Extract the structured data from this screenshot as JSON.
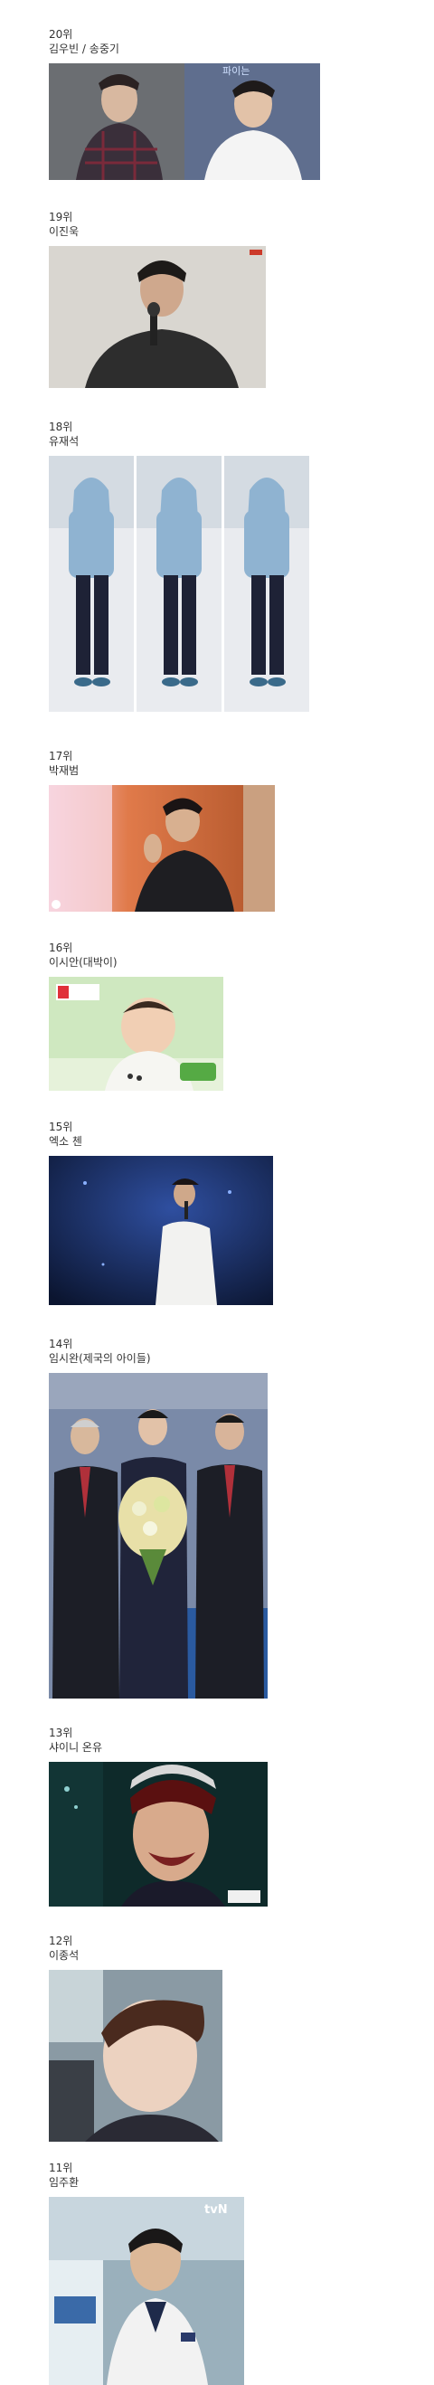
{
  "entries": [
    {
      "rank": "20위",
      "name": "김우빈 / 송중기",
      "photo_desc": "portrait-pair",
      "badge": "파이는"
    },
    {
      "rank": "19위",
      "name": "이진욱",
      "photo_desc": "portrait-mic"
    },
    {
      "rank": "18위",
      "name": "유재석",
      "photo_desc": "triple-walking"
    },
    {
      "rank": "17위",
      "name": "박재범",
      "photo_desc": "stage-waving"
    },
    {
      "rank": "16위",
      "name": "이시안(대박이)",
      "photo_desc": "baby-tv"
    },
    {
      "rank": "15위",
      "name": "엑소 첸",
      "photo_desc": "singer-stage"
    },
    {
      "rank": "14위",
      "name": "임시완(제국의 아이들)",
      "photo_desc": "award-flowers"
    },
    {
      "rank": "13위",
      "name": "샤이니 온유",
      "photo_desc": "laughing-closeup"
    },
    {
      "rank": "12위",
      "name": "이종석",
      "photo_desc": "selfie-car"
    },
    {
      "rank": "11위",
      "name": "임주환",
      "photo_desc": "uniform-tvn",
      "badge": "tvN"
    }
  ]
}
